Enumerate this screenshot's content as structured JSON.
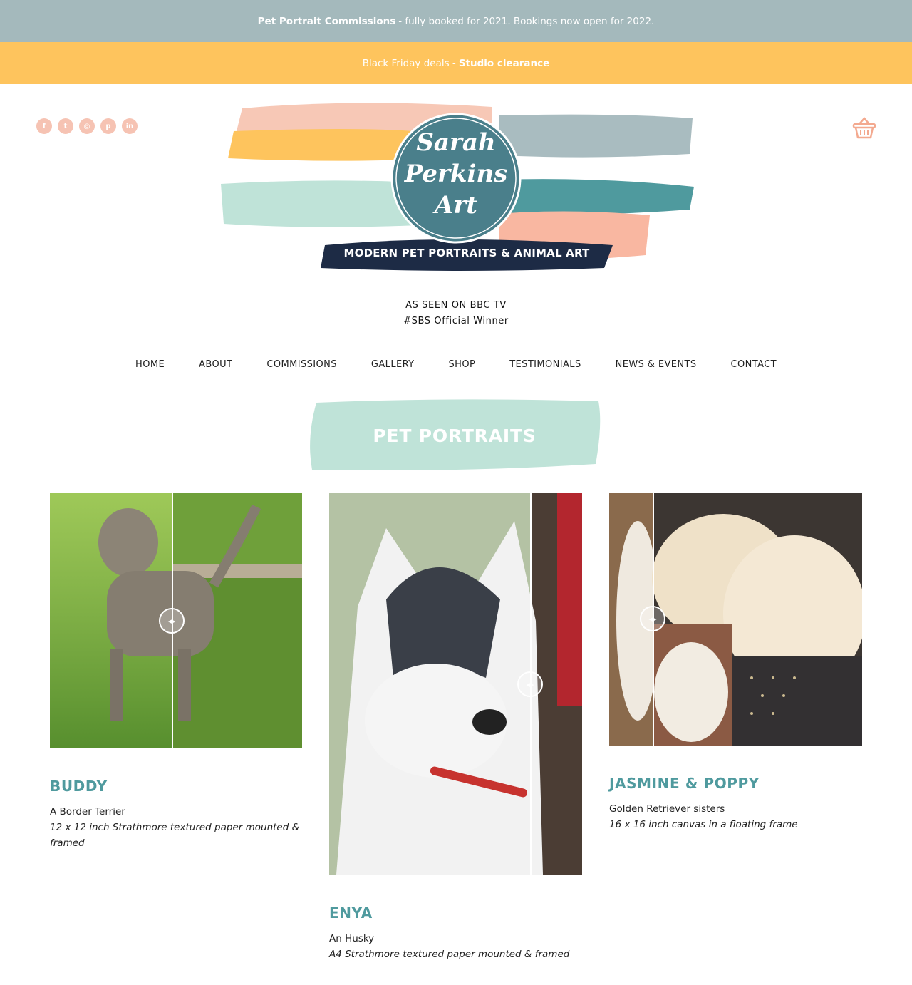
{
  "topbar": {
    "bold": "Pet Portrait Commissions",
    "text": "- fully booked for 2021. Bookings now open for 2022."
  },
  "promobar": {
    "text": "Black Friday deals -",
    "bold": "Studio clearance"
  },
  "social": [
    {
      "icon": "facebook-icon",
      "glyph": "f"
    },
    {
      "icon": "twitter-icon",
      "glyph": "t"
    },
    {
      "icon": "instagram-icon",
      "glyph": "◎"
    },
    {
      "icon": "pinterest-icon",
      "glyph": "p"
    },
    {
      "icon": "linkedin-icon",
      "glyph": "in"
    }
  ],
  "logo": {
    "line1": "Sarah",
    "line2": "Perkins",
    "line3": "Art",
    "banner": "MODERN PET PORTRAITS & ANIMAL ART"
  },
  "tagline": {
    "line1": "AS SEEN ON BBC TV",
    "line2": "#SBS Official Winner"
  },
  "nav": [
    "HOME",
    "ABOUT",
    "COMMISSIONS",
    "GALLERY",
    "SHOP",
    "TESTIMONIALS",
    "NEWS & EVENTS",
    "CONTACT"
  ],
  "section_title": "PET PORTRAITS",
  "portraits": [
    {
      "name": "BUDDY",
      "breed": "A Border Terrier",
      "details": "12 x 12 inch Strathmore textured paper mounted & framed"
    },
    {
      "name": "ENYA",
      "breed": "An Husky",
      "details": "A4 Strathmore textured paper mounted & framed"
    },
    {
      "name": "JASMINE & POPPY",
      "breed": "Golden Retriever sisters",
      "details": "16 x 16 inch canvas in a floating frame"
    }
  ],
  "colors": {
    "topbar": "#a4b9bc",
    "promobar": "#fec45d",
    "accent_teal": "#4f9a9e",
    "peach": "#f6c3b3",
    "navy": "#1d2b45"
  }
}
